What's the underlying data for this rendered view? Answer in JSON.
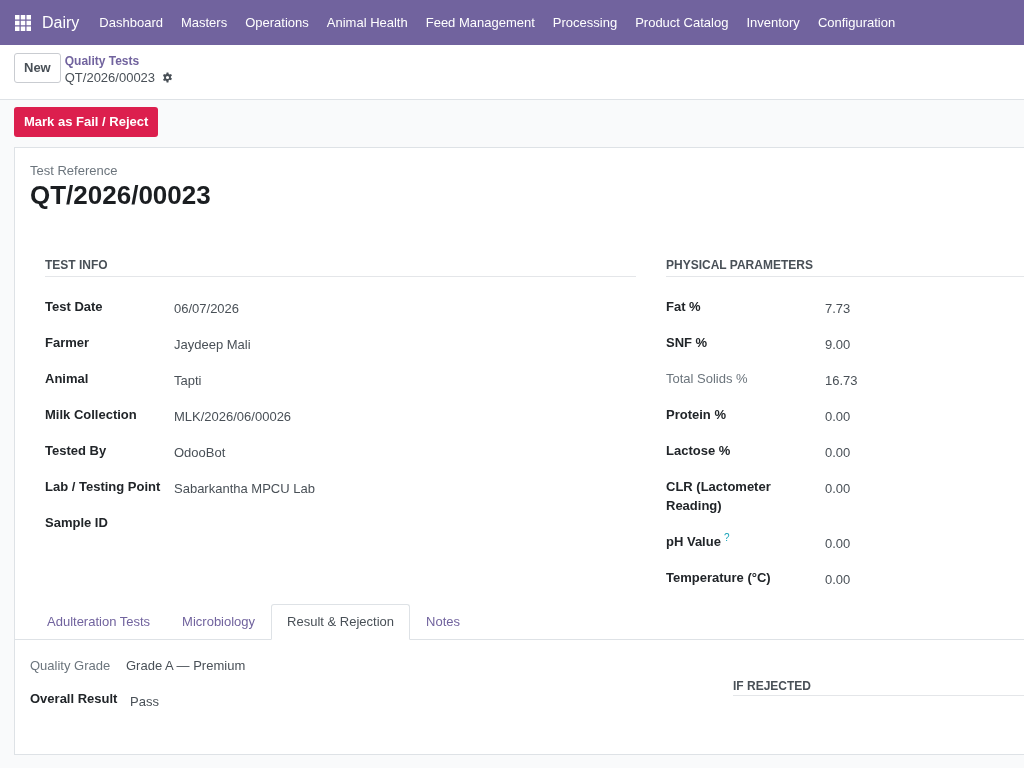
{
  "navbar": {
    "app_name": "Dairy",
    "menu": [
      "Dashboard",
      "Masters",
      "Operations",
      "Animal Health",
      "Feed Management",
      "Processing",
      "Product Catalog",
      "Inventory",
      "Configuration"
    ]
  },
  "control_panel": {
    "new_button": "New",
    "breadcrumb": {
      "parent": "Quality Tests",
      "current": "QT/2026/00023"
    }
  },
  "status_bar": {
    "buttons": [
      {
        "label": "Mark as Fail / Reject",
        "kind": "danger"
      }
    ]
  },
  "sheet": {
    "reference_label": "Test Reference",
    "reference": "QT/2026/00023",
    "groups": [
      {
        "title": "TEST INFO",
        "fields": [
          {
            "label": "Test Date",
            "value": "06/07/2026",
            "muted": false
          },
          {
            "label": "Farmer",
            "value": "Jaydeep Mali",
            "muted": false
          },
          {
            "label": "Animal",
            "value": "Tapti",
            "muted": false
          },
          {
            "label": "Milk Collection",
            "value": "MLK/2026/06/00026",
            "muted": false
          },
          {
            "label": "Tested By",
            "value": "OdooBot",
            "muted": false
          },
          {
            "label": "Lab / Testing Point",
            "value": "Sabarkantha MPCU Lab",
            "muted": false
          },
          {
            "label": "Sample ID",
            "muted": false
          }
        ]
      },
      {
        "title": "PHYSICAL PARAMETERS",
        "fields": [
          {
            "label": "Fat %",
            "value": "7.73",
            "muted": false
          },
          {
            "label": "SNF %",
            "value": "9.00",
            "muted": false
          },
          {
            "label": "Total Solids %",
            "value": "16.73",
            "muted": true
          },
          {
            "label": "Protein %",
            "value": "0.00",
            "muted": false
          },
          {
            "label": "Lactose %",
            "value": "0.00",
            "muted": false
          },
          {
            "label": "CLR (Lactometer Reading)",
            "value": "0.00",
            "muted": false
          },
          {
            "label": "pH Value",
            "help": "?",
            "value": "0.00",
            "muted": false
          },
          {
            "label": "Temperature (°C)",
            "value": "0.00",
            "muted": false
          }
        ]
      }
    ],
    "tabs": [
      {
        "label": "Adulteration Tests",
        "selected": false
      },
      {
        "label": "Microbiology",
        "selected": false
      },
      {
        "label": "Result & Rejection",
        "selected": true
      },
      {
        "label": "Notes",
        "selected": false
      }
    ],
    "tab_content": {
      "fields": [
        {
          "label": "Quality Grade",
          "value": "Grade A — Premium",
          "muted": true
        },
        {
          "label": "Overall Result",
          "value": "Pass",
          "muted": false
        }
      ],
      "section_title": "IF REJECTED"
    }
  }
}
